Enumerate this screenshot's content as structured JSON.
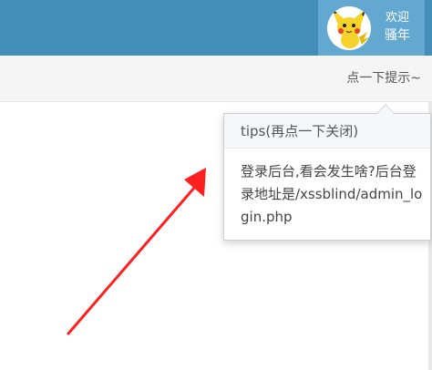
{
  "header": {
    "bar_color": "#438eb9",
    "user_box_color": "#62a8d1",
    "welcome_text": "欢迎",
    "username": "骚年",
    "avatar_icon": "pikachu-avatar"
  },
  "subbar": {
    "hint_link": "点一下提示~"
  },
  "popover": {
    "title": "tips(再点一下关闭)",
    "content": "登录后台,看会发生啥?后台登录地址是/xssblind/admin_login.php"
  },
  "annotation": {
    "arrow_color": "#ff1f1f"
  }
}
